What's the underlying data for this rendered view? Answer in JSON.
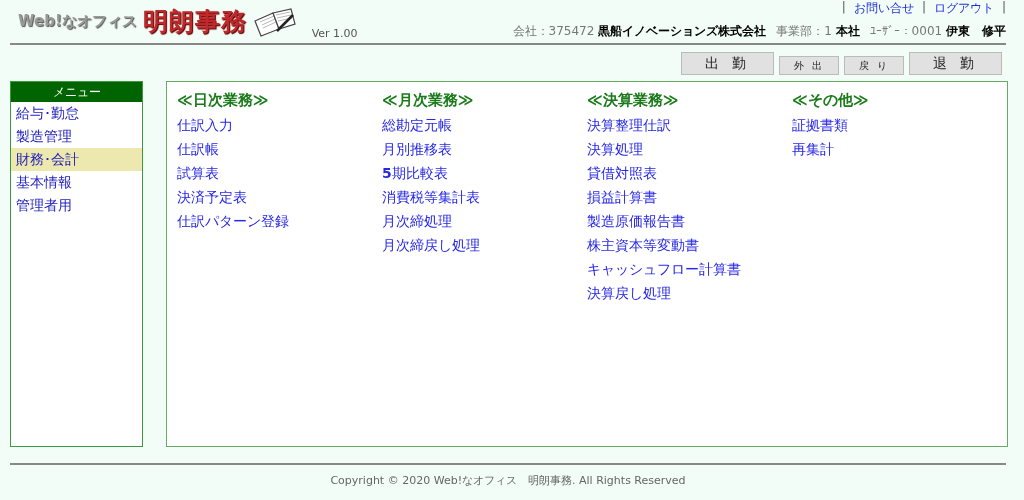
{
  "header": {
    "logo_sub": "Web!なオフィス",
    "logo_main": "明朗事務",
    "version": "Ver 1.00",
    "links": [
      {
        "label": "お問い合せ"
      },
      {
        "label": "ログアウト"
      }
    ],
    "separators": [
      "|",
      "|",
      "|"
    ],
    "info": [
      {
        "label": "会社：",
        "code": "375472",
        "name": "黒船イノベーションズ株式会社"
      },
      {
        "label": "事業部：",
        "code": "1",
        "name": "本社"
      },
      {
        "label": "ﾕｰｻﾞｰ：",
        "code": "0001",
        "name": "伊東　修平"
      }
    ]
  },
  "buttons": [
    {
      "label": "出 勤",
      "kind": "large"
    },
    {
      "label": "外 出",
      "kind": "small"
    },
    {
      "label": "戻 り",
      "kind": "small"
    },
    {
      "label": "退 勤",
      "kind": "large"
    }
  ],
  "sidebar": {
    "title": "メニュー",
    "items": [
      {
        "label": "給与･勤怠",
        "selected": false
      },
      {
        "label": "製造管理",
        "selected": false
      },
      {
        "label": "財務･会計",
        "selected": true
      },
      {
        "label": "基本情報",
        "selected": false
      },
      {
        "label": "管理者用",
        "selected": false
      }
    ]
  },
  "sections": [
    {
      "title": "≪日次業務≫",
      "items": [
        "仕訳入力",
        "仕訳帳",
        "試算表",
        "決済予定表",
        "仕訳パターン登録"
      ]
    },
    {
      "title": "≪月次業務≫",
      "items": [
        "総勘定元帳",
        "月別推移表",
        "**5**期比較表",
        "消費税等集計表",
        "月次締処理",
        "月次締戻し処理"
      ]
    },
    {
      "title": "≪決算業務≫",
      "items": [
        "決算整理仕訳",
        "決算処理",
        "貸借対照表",
        "損益計算書",
        "製造原価報告書",
        "株主資本等変動書",
        "キャッシュフロー計算書",
        "決算戻し処理"
      ]
    },
    {
      "title": "≪その他≫",
      "items": [
        "証拠書類",
        "再集計"
      ]
    }
  ],
  "footer": "Copyright © 2020 Web!なオフィス　明朗事務. All Rights Reserved"
}
